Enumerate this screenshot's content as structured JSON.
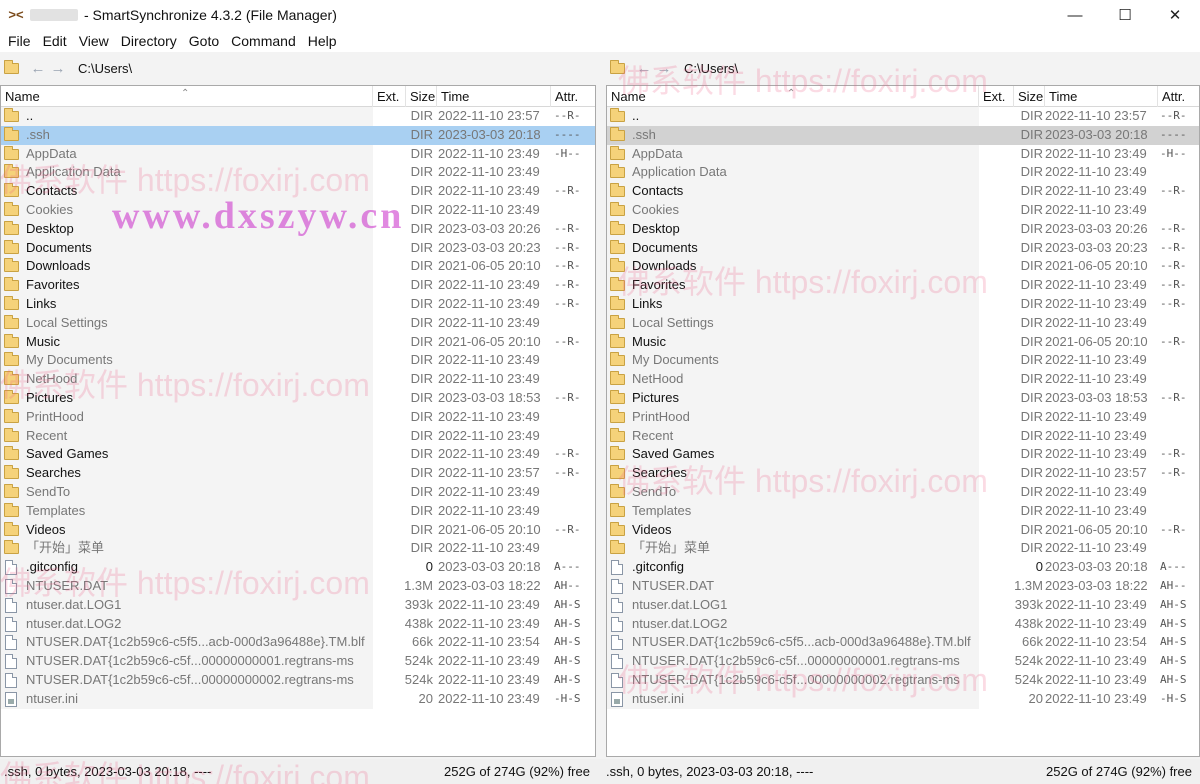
{
  "window": {
    "title": "- SmartSynchronize 4.3.2 (File Manager)",
    "minimize": "—",
    "maximize": "☐",
    "close": "✕"
  },
  "menu": [
    "File",
    "Edit",
    "View",
    "Directory",
    "Goto",
    "Command",
    "Help"
  ],
  "left": {
    "path": "C:\\Users\\",
    "status": ".ssh, 0 bytes, 2023-03-03 20:18, ----",
    "free": "252G of 274G (92%) free"
  },
  "right": {
    "path": "C:\\Users\\",
    "status": ".ssh, 0 bytes, 2023-03-03 20:18, ----",
    "free": "252G of 274G (92%) free"
  },
  "columns": {
    "name": "Name",
    "ext": "Ext.",
    "size": "Size",
    "time": "Time",
    "attr": "Attr."
  },
  "rows": [
    {
      "icon": "folder",
      "name": "..",
      "size": "DIR",
      "time": "2022-11-10 23:57",
      "attr": "--R-",
      "dim": false
    },
    {
      "icon": "folder",
      "name": ".ssh",
      "size": "DIR",
      "time": "2023-03-03 20:18",
      "attr": "----",
      "dim": true
    },
    {
      "icon": "folder",
      "name": "AppData",
      "size": "DIR",
      "time": "2022-11-10 23:49",
      "attr": "-H--",
      "dim": true
    },
    {
      "icon": "folder",
      "name": "Application Data",
      "size": "DIR",
      "time": "2022-11-10 23:49",
      "attr": "",
      "dim": true
    },
    {
      "icon": "folder",
      "name": "Contacts",
      "size": "DIR",
      "time": "2022-11-10 23:49",
      "attr": "--R-",
      "dim": false
    },
    {
      "icon": "folder",
      "name": "Cookies",
      "size": "DIR",
      "time": "2022-11-10 23:49",
      "attr": "",
      "dim": true
    },
    {
      "icon": "folder",
      "name": "Desktop",
      "size": "DIR",
      "time": "2023-03-03 20:26",
      "attr": "--R-",
      "dim": false
    },
    {
      "icon": "folder",
      "name": "Documents",
      "size": "DIR",
      "time": "2023-03-03 20:23",
      "attr": "--R-",
      "dim": false
    },
    {
      "icon": "folder",
      "name": "Downloads",
      "size": "DIR",
      "time": "2021-06-05 20:10",
      "attr": "--R-",
      "dim": false
    },
    {
      "icon": "folder",
      "name": "Favorites",
      "size": "DIR",
      "time": "2022-11-10 23:49",
      "attr": "--R-",
      "dim": false
    },
    {
      "icon": "folder",
      "name": "Links",
      "size": "DIR",
      "time": "2022-11-10 23:49",
      "attr": "--R-",
      "dim": false
    },
    {
      "icon": "folder",
      "name": "Local Settings",
      "size": "DIR",
      "time": "2022-11-10 23:49",
      "attr": "",
      "dim": true
    },
    {
      "icon": "folder",
      "name": "Music",
      "size": "DIR",
      "time": "2021-06-05 20:10",
      "attr": "--R-",
      "dim": false
    },
    {
      "icon": "folder",
      "name": "My Documents",
      "size": "DIR",
      "time": "2022-11-10 23:49",
      "attr": "",
      "dim": true
    },
    {
      "icon": "folder",
      "name": "NetHood",
      "size": "DIR",
      "time": "2022-11-10 23:49",
      "attr": "",
      "dim": true
    },
    {
      "icon": "folder",
      "name": "Pictures",
      "size": "DIR",
      "time": "2023-03-03 18:53",
      "attr": "--R-",
      "dim": false
    },
    {
      "icon": "folder",
      "name": "PrintHood",
      "size": "DIR",
      "time": "2022-11-10 23:49",
      "attr": "",
      "dim": true
    },
    {
      "icon": "folder",
      "name": "Recent",
      "size": "DIR",
      "time": "2022-11-10 23:49",
      "attr": "",
      "dim": true
    },
    {
      "icon": "folder",
      "name": "Saved Games",
      "size": "DIR",
      "time": "2022-11-10 23:49",
      "attr": "--R-",
      "dim": false
    },
    {
      "icon": "folder",
      "name": "Searches",
      "size": "DIR",
      "time": "2022-11-10 23:57",
      "attr": "--R-",
      "dim": false
    },
    {
      "icon": "folder",
      "name": "SendTo",
      "size": "DIR",
      "time": "2022-11-10 23:49",
      "attr": "",
      "dim": true
    },
    {
      "icon": "folder",
      "name": "Templates",
      "size": "DIR",
      "time": "2022-11-10 23:49",
      "attr": "",
      "dim": true
    },
    {
      "icon": "folder",
      "name": "Videos",
      "size": "DIR",
      "time": "2021-06-05 20:10",
      "attr": "--R-",
      "dim": false
    },
    {
      "icon": "folder",
      "name": "「开始」菜单",
      "size": "DIR",
      "time": "2022-11-10 23:49",
      "attr": "",
      "dim": true
    },
    {
      "icon": "file",
      "name": ".gitconfig",
      "size": "0",
      "time": "2023-03-03 20:18",
      "attr": "A---",
      "dim": false
    },
    {
      "icon": "file",
      "name": "NTUSER.DAT",
      "size": "1.3M",
      "time": "2023-03-03 18:22",
      "attr": "AH--",
      "dim": true
    },
    {
      "icon": "file",
      "name": "ntuser.dat.LOG1",
      "size": "393k",
      "time": "2022-11-10 23:49",
      "attr": "AH-S",
      "dim": true
    },
    {
      "icon": "file",
      "name": "ntuser.dat.LOG2",
      "size": "438k",
      "time": "2022-11-10 23:49",
      "attr": "AH-S",
      "dim": true
    },
    {
      "icon": "file",
      "name": "NTUSER.DAT{1c2b59c6-c5f5...acb-000d3a96488e}.TM.blf",
      "size": "66k",
      "time": "2022-11-10 23:54",
      "attr": "AH-S",
      "dim": true
    },
    {
      "icon": "file",
      "name": "NTUSER.DAT{1c2b59c6-c5f...00000000001.regtrans-ms",
      "size": "524k",
      "time": "2022-11-10 23:49",
      "attr": "AH-S",
      "dim": true
    },
    {
      "icon": "file",
      "name": "NTUSER.DAT{1c2b59c6-c5f...00000000002.regtrans-ms",
      "size": "524k",
      "time": "2022-11-10 23:49",
      "attr": "AH-S",
      "dim": true
    },
    {
      "icon": "ini",
      "name": "ntuser.ini",
      "size": "20",
      "time": "2022-11-10 23:49",
      "attr": "-H-S",
      "dim": true
    }
  ],
  "selected_index": 1,
  "watermark": {
    "foxirj": "佛系软件 https://foxirj.com",
    "dxszyw": "www.dxszyw.cn"
  }
}
